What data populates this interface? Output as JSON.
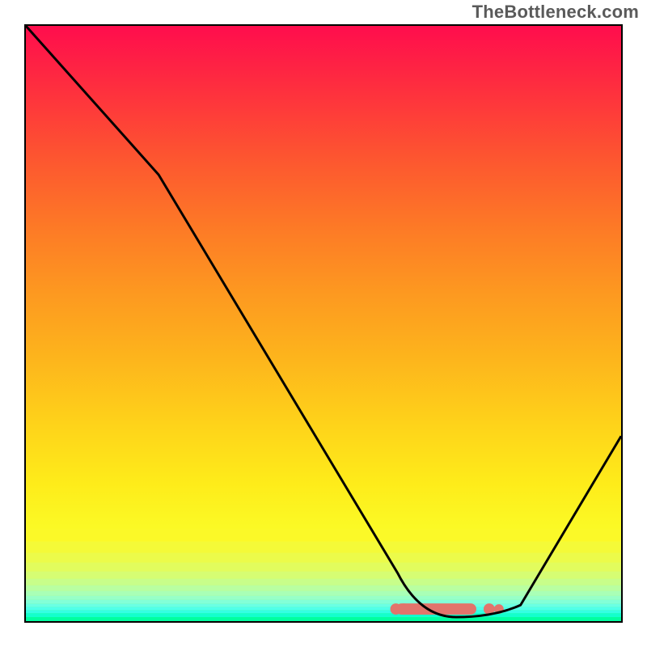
{
  "watermark": "TheBottleneck.com",
  "chart_data": {
    "type": "line",
    "title": "",
    "xlabel": "",
    "ylabel": "",
    "xlim": [
      0,
      100
    ],
    "ylim": [
      0,
      100
    ],
    "grid": false,
    "background_gradient": {
      "top_colors": [
        "#ff0d4d",
        "#fe2d3f",
        "#fd5530",
        "#fd7a26",
        "#fd9920",
        "#fdb51c",
        "#fed31a",
        "#feec1a",
        "#fbf925",
        "#e8fb50",
        "#c7ff92",
        "#91ffca",
        "#58ffe9",
        "#00ffa0"
      ],
      "description": "vertical gradient red→orange→yellow→green with thin horizontal bands near the bottom"
    },
    "series": [
      {
        "name": "curve",
        "x": [
          0,
          22,
          62.5,
          66,
          72,
          78,
          83,
          100
        ],
        "y": [
          100,
          75,
          8,
          2,
          0,
          0,
          2,
          31
        ]
      }
    ],
    "markers": {
      "name": "salmon-marker-band",
      "shape": "rounded-rect",
      "color": "#e2746c",
      "x_start": 62,
      "x_end": 79,
      "y": 1.5,
      "height": 2
    }
  }
}
